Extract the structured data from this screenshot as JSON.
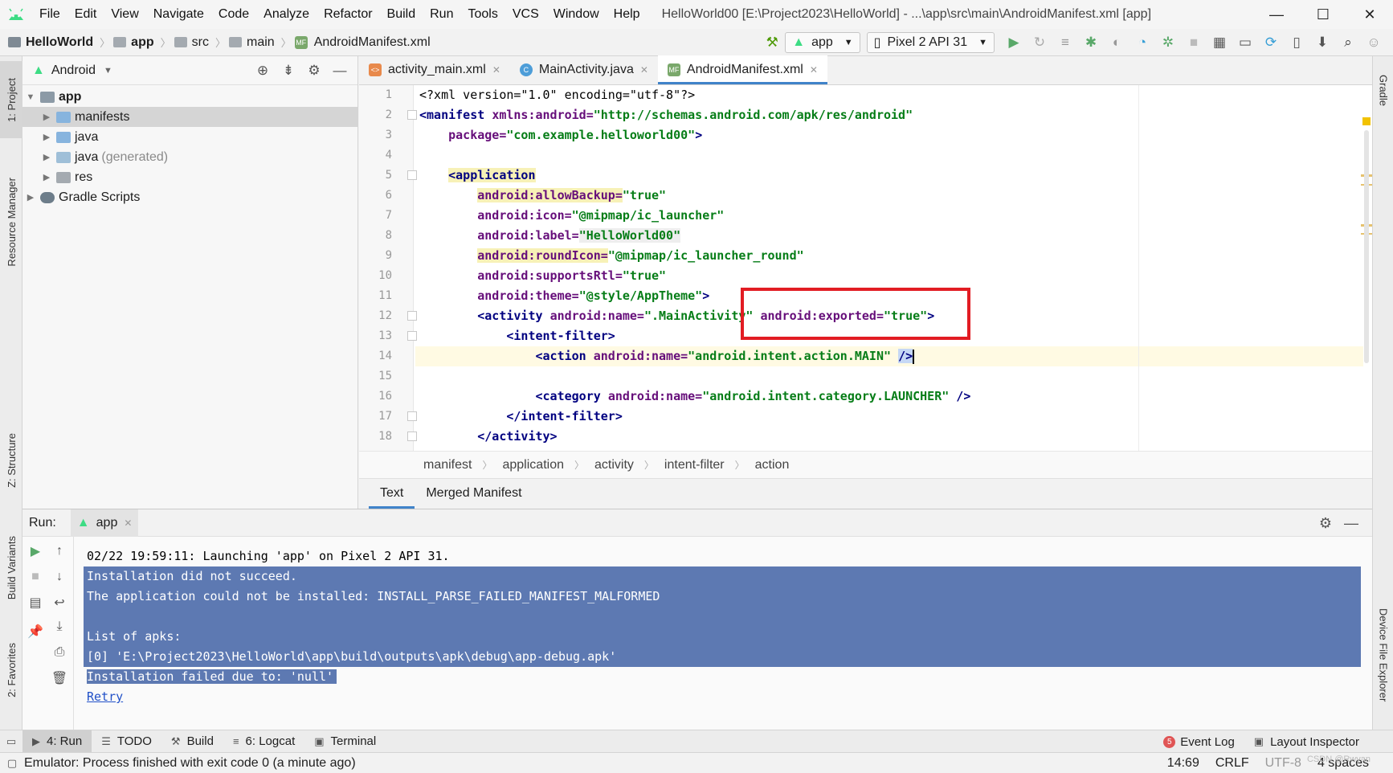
{
  "menubar": {
    "items": [
      "File",
      "Edit",
      "View",
      "Navigate",
      "Code",
      "Analyze",
      "Refactor",
      "Build",
      "Run",
      "Tools",
      "VCS",
      "Window",
      "Help"
    ],
    "window_title": "HelloWorld00 [E:\\Project2023\\HelloWorld] - ...\\app\\src\\main\\AndroidManifest.xml [app]",
    "controls": [
      "—",
      "☐",
      "✕"
    ]
  },
  "navbar": {
    "crumbs": [
      "HelloWorld",
      "app",
      "src",
      "main",
      "AndroidManifest.xml"
    ],
    "run_config": "app",
    "device": "Pixel 2 API 31"
  },
  "left_strip": {
    "tabs": [
      "1: Project",
      "Resource Manager",
      "Z: Structure",
      "Build Variants",
      "2: Favorites"
    ]
  },
  "right_strip": {
    "tabs": [
      "Gradle",
      "Device File Explorer"
    ]
  },
  "project": {
    "view": "Android",
    "tree": [
      {
        "label": "app",
        "depth": 0,
        "expanded": true
      },
      {
        "label": "manifests",
        "depth": 1,
        "selected": true
      },
      {
        "label": "java",
        "depth": 1
      },
      {
        "label": "java",
        "suffix": "(generated)",
        "depth": 1
      },
      {
        "label": "res",
        "depth": 1
      },
      {
        "label": "Gradle Scripts",
        "depth": 0
      }
    ]
  },
  "editor": {
    "tabs": [
      {
        "label": "activity_main.xml",
        "type": "xml"
      },
      {
        "label": "MainActivity.java",
        "type": "java"
      },
      {
        "label": "AndroidManifest.xml",
        "type": "mf",
        "active": true
      }
    ],
    "line_numbers": [
      "1",
      "2",
      "3",
      "4",
      "5",
      "6",
      "7",
      "8",
      "9",
      "10",
      "11",
      "12",
      "13",
      "14",
      "15",
      "16",
      "17",
      "18"
    ],
    "code": {
      "l1": "<?xml version=\"1.0\" encoding=\"utf-8\"?>",
      "l2_tag": "<manifest",
      "l2_attr": "xmlns:android=",
      "l2_val": "\"http://schemas.android.com/apk/res/android\"",
      "l3_attr": "package=",
      "l3_val": "\"com.example.helloworld00\"",
      "l3_end": ">",
      "l5_tag": "<application",
      "l6_attr": "android:allowBackup=",
      "l6_val": "\"true\"",
      "l7_attr": "android:icon=",
      "l7_val": "\"@mipmap/ic_launcher\"",
      "l8_attr": "android:label=",
      "l8_val": "\"HelloWorld00\"",
      "l9_attr": "android:roundIcon=",
      "l9_val": "\"@mipmap/ic_launcher_round\"",
      "l10_attr": "android:supportsRtl=",
      "l10_val": "\"true\"",
      "l11_attr": "android:theme=",
      "l11_val": "\"@style/AppTheme\"",
      "l11_end": ">",
      "l12_tag": "<activity",
      "l12_attr": "android:name=",
      "l12_val": "\".MainActivity\"",
      "l12_attr2": "android:exported=",
      "l12_val2": "\"true\"",
      "l12_end": ">",
      "l13_tag": "<intent-filter>",
      "l14_tag": "<action",
      "l14_attr": "android:name=",
      "l14_val": "\"android.intent.action.MAIN\"",
      "l14_end": "/>",
      "l16_tag": "<category",
      "l16_attr": "android:name=",
      "l16_val": "\"android.intent.category.LAUNCHER\"",
      "l16_end": "/>",
      "l17_tag": "</intent-filter>",
      "l18_tag": "</activity>"
    },
    "breadcrumbs": [
      "manifest",
      "application",
      "activity",
      "intent-filter",
      "action"
    ],
    "subtabs": [
      "Text",
      "Merged Manifest"
    ]
  },
  "run": {
    "label": "Run:",
    "tab": "app",
    "lines": [
      "02/22 19:59:11: Launching 'app' on Pixel 2 API 31.",
      "Installation did not succeed.",
      "The application could not be installed: INSTALL_PARSE_FAILED_MANIFEST_MALFORMED",
      "",
      "List of apks:",
      "[0] 'E:\\Project2023\\HelloWorld\\app\\build\\outputs\\apk\\debug\\app-debug.apk'",
      "Installation failed due to: 'null'"
    ],
    "retry": "Retry"
  },
  "bottom_tabs": {
    "left": [
      {
        "label": "4: Run",
        "icon": "▶",
        "active": true
      },
      {
        "label": "TODO",
        "icon": "☰"
      },
      {
        "label": "Build",
        "icon": "⚒"
      },
      {
        "label": "6: Logcat",
        "icon": "≡"
      },
      {
        "label": "Terminal",
        "icon": "▣"
      }
    ],
    "event_log": "Event Log",
    "event_count": "5",
    "layout_inspector": "Layout Inspector"
  },
  "status": {
    "message": "Emulator: Process finished with exit code 0 (a minute ago)",
    "position": "14:69",
    "line_sep": "CRLF",
    "encoding": "UTF-8",
    "indent": "4 spaces",
    "watermark": "CSDN @Rwyan"
  },
  "colors": {
    "accent": "#4083c9",
    "highlight_box": "#e21c23",
    "selection": "#5d79b2",
    "android_green": "#3ddc84"
  }
}
